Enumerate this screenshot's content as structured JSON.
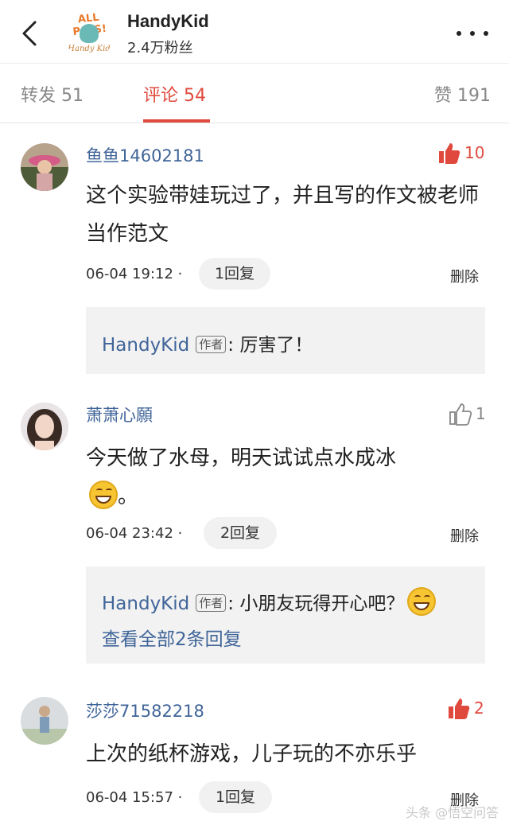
{
  "header": {
    "back_icon": "chevron-left-icon",
    "logo_top": "ALL PASS!",
    "logo_bottom": "Handy Kid",
    "account_name": "HandyKid",
    "fans": "2.4万粉丝",
    "more_icon": "more-horizontal-icon"
  },
  "tabs": {
    "repost": "转发 51",
    "comments": "评论 54",
    "likes": "赞 191",
    "active_color": "#e04a3e"
  },
  "comments": [
    {
      "username": "鱼鱼14602181",
      "likes": "10",
      "liked": true,
      "text": "这个实验带娃玩过了，并且写的作文被老师当作范文",
      "time": "06-04 19:12",
      "sep": "·",
      "replies": "1回复",
      "delete": "删除",
      "reply_author": "HandyKid",
      "author_tag": "作者",
      "reply_text": ": 厉害了！"
    },
    {
      "username": "萧萧心願",
      "likes": "1",
      "liked": false,
      "text_line1": "今天做了水母，明天试试点水成冰",
      "text_line2": "。",
      "time": "06-04 23:42",
      "sep": "·",
      "replies": "2回复",
      "delete": "删除",
      "reply_author": "HandyKid",
      "author_tag": "作者",
      "reply_text": ": 小朋友玩得开心吧？",
      "view_all": "查看全部2条回复"
    },
    {
      "username": "莎莎71582218",
      "likes": "2",
      "liked": true,
      "text": "上次的纸杯游戏，儿子玩的不亦乐乎",
      "time": "06-04 15:57",
      "sep": "·",
      "replies": "1回复",
      "delete": "删除"
    }
  ],
  "watermark": "头条 @悟空问答",
  "colors": {
    "link_blue": "#406599",
    "like_red": "#e04a3e",
    "grey_text": "#888888"
  }
}
